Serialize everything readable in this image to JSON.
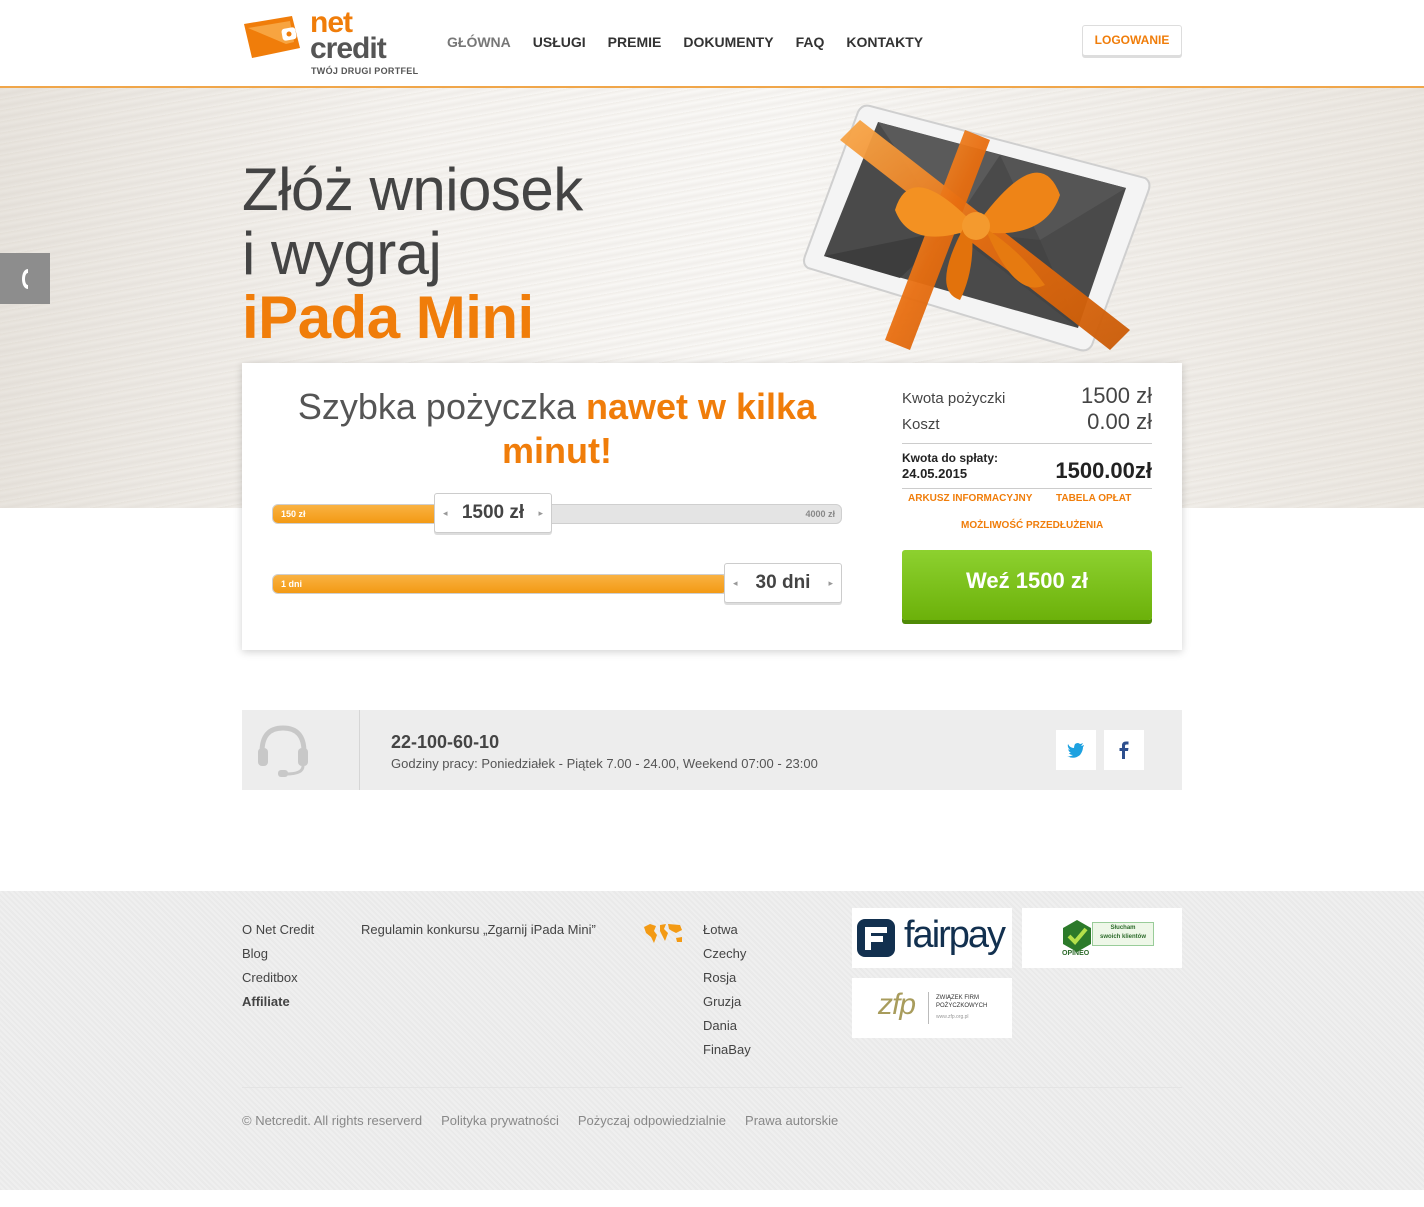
{
  "header": {
    "logo": {
      "top": "net",
      "bottom": "credit",
      "tagline": "TWÓJ DRUGI PORTFEL"
    },
    "nav": [
      "GŁÓWNA",
      "USŁUGI",
      "PREMIE",
      "DOKUMENTY",
      "FAQ",
      "KONTAKTY"
    ],
    "login_label": "LOGOWANIE"
  },
  "hero": {
    "line1": "Złóż wniosek",
    "line2": "i wygraj",
    "line3": "iPada Mini"
  },
  "loan": {
    "title_plain": "Szybka pożyczka ",
    "title_accent": "nawet w kilka minut!",
    "amount_slider": {
      "min_label": "150 zł",
      "max_label": "4000 zł",
      "value": "1500 zł",
      "fraction": 0.32
    },
    "days_slider": {
      "min_label": "1 dni",
      "value": "30 dni",
      "fraction": 0.8
    },
    "summary": {
      "amount_label": "Kwota pożyczki",
      "amount_value": "1500 zł",
      "cost_label": "Koszt",
      "cost_value": "0.00 zł",
      "due_label": "Kwota do spłaty:",
      "due_date": "24.05.2015",
      "due_value": "1500.00zł",
      "link_info": "ARKUSZ INFORMACYJNY",
      "link_fees": "TABELA OPŁAT",
      "link_extend": "MOŻLIWOŚĆ PRZEDŁUŻENIA"
    },
    "cta_label": "Weź 1500 zł"
  },
  "contact": {
    "phone": "22-100-60-10",
    "hours": "Godziny pracy: Poniedziałek - Piątek 7.00 - 24.00, Weekend 07:00 - 23:00"
  },
  "footer": {
    "col1": [
      "O Net Credit",
      "Blog",
      "Creditbox",
      "Affiliate"
    ],
    "col2": [
      "Regulamin konkursu „Zgarnij iPada Mini”"
    ],
    "countries": [
      "Łotwa",
      "Czechy",
      "Rosja",
      "Gruzja",
      "Dania",
      "FinaBay"
    ],
    "badges": {
      "fairpay": "fairpay",
      "opineo_top": "Słucham",
      "opineo_bottom": "swoich klientów",
      "opineo_name": "OPINEO",
      "zfp_logo": "zfp",
      "zfp_line1": "ZWIĄZEK FIRM",
      "zfp_line2": "POŻYCZKOWYCH",
      "zfp_url": "www.zfp.org.pl"
    },
    "bottom": [
      "© Netcredit. All rights reserverd",
      "Polityka prywatności",
      "Pożyczaj odpowiedzialnie",
      "Prawa autorskie"
    ]
  },
  "colors": {
    "accent": "#f07d0a",
    "cta": "#78bb12"
  }
}
